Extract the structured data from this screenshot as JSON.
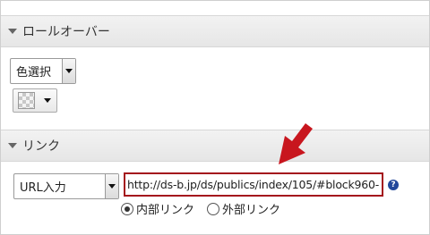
{
  "rollover": {
    "title": "ロールオーバー",
    "select_value": "色選択",
    "color_swatch": "transparent-checker"
  },
  "link": {
    "title": "リンク",
    "select_value": "URL入力",
    "url_value": "http://ds-b.jp/ds/publics/index/105/#block960-",
    "help_icon_text": "?",
    "radios": [
      {
        "label": "内部リンク",
        "checked": true
      },
      {
        "label": "外部リンク",
        "checked": false
      }
    ]
  },
  "colors": {
    "highlight": "#a4141c",
    "arrow": "#c8161e"
  },
  "icons": [
    "chevron-down-icon",
    "checkerboard-swatch-icon",
    "help-icon",
    "red-arrow-icon"
  ]
}
